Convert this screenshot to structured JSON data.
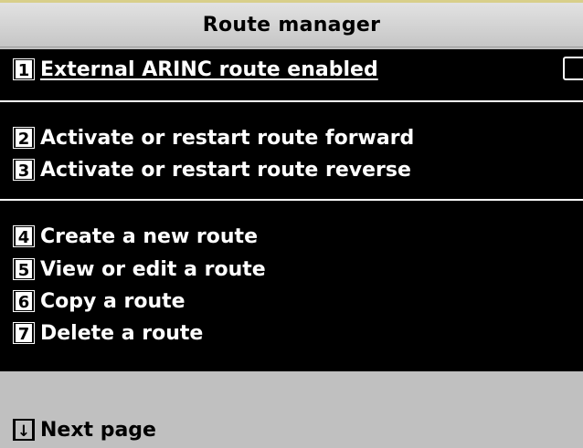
{
  "title": "Route manager",
  "options": [
    {
      "key": "1",
      "label": "External ARINC route enabled"
    },
    {
      "key": "2",
      "label": "Activate or restart route forward"
    },
    {
      "key": "3",
      "label": "Activate or restart route reverse"
    },
    {
      "key": "4",
      "label": "Create a new route"
    },
    {
      "key": "5",
      "label": "View or edit a route"
    },
    {
      "key": "6",
      "label": "Copy a route"
    },
    {
      "key": "7",
      "label": "Delete a route"
    }
  ],
  "arinc_checkbox": {
    "checked": false
  },
  "footer": {
    "key_glyph": "↓",
    "label": "Next page"
  },
  "colors": {
    "panel": "#000000",
    "background": "#c0c0c0",
    "text": "#ffffff"
  }
}
